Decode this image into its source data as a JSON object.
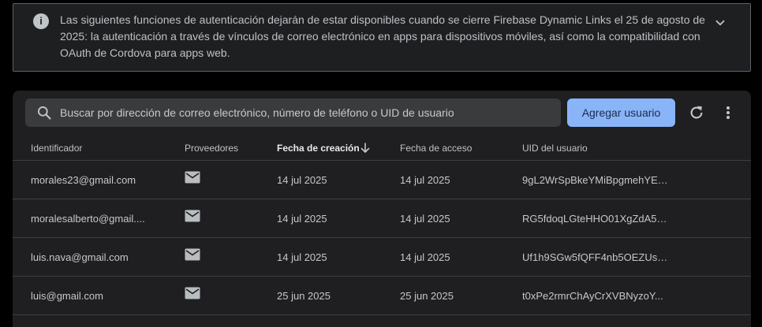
{
  "banner": {
    "text": "Las siguientes funciones de autenticación dejarán de estar disponibles cuando se cierre Firebase Dynamic Links el 25 de agosto de 2025: la autenticación a través de vínculos de correo electrónico en apps para dispositivos móviles, así como la compatibilidad con OAuth de Cordova para apps web.",
    "info_icon": "info-icon",
    "toggle_icon": "chevron-down-icon"
  },
  "search": {
    "placeholder": "Buscar por dirección de correo electrónico, número de teléfono o UID de usuario",
    "value": ""
  },
  "toolbar": {
    "add_user_label": "Agregar usuario",
    "refresh_icon": "refresh-icon",
    "more_icon": "more-vert-icon"
  },
  "table": {
    "columns": {
      "identifier": "Identificador",
      "providers": "Proveedores",
      "created": "Fecha de creación",
      "last_sign_in": "Fecha de acceso",
      "uid": "UID del usuario"
    },
    "sorted_by": "created",
    "sort_direction": "descending",
    "rows": [
      {
        "identifier": "morales23@gmail.com",
        "provider_icon": "email-icon",
        "created": "14 jul 2025",
        "last_sign_in": "14 jul 2025",
        "uid": "9gL2WrSpBkeYMiBpgmehYE8..."
      },
      {
        "identifier": "moralesalberto@gmail....",
        "provider_icon": "email-icon",
        "created": "14 jul 2025",
        "last_sign_in": "14 jul 2025",
        "uid": "RG5fdoqLGteHHO01XgZdA5M..."
      },
      {
        "identifier": "luis.nava@gmail.com",
        "provider_icon": "email-icon",
        "created": "14 jul 2025",
        "last_sign_in": "14 jul 2025",
        "uid": "Uf1h9SGw5fQFF4nb5OEZUsa..."
      },
      {
        "identifier": "luis@gmail.com",
        "provider_icon": "email-icon",
        "created": "25 jun 2025",
        "last_sign_in": "25 jun 2025",
        "uid": "t0xPe2rmrChAyCrXVBNyzoY..."
      }
    ]
  },
  "colors": {
    "accent": "#8ab4f8",
    "card_bg": "#1f1f21",
    "banner_bg": "#1e1f21"
  }
}
